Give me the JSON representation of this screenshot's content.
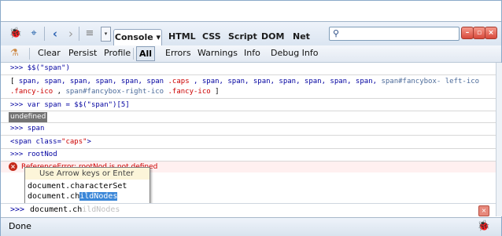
{
  "toolbar": {
    "tabs": [
      {
        "label": "Console",
        "arrow": "▾"
      },
      {
        "label": "HTML"
      },
      {
        "label": "CSS"
      },
      {
        "label": "Script"
      },
      {
        "label": "DOM"
      },
      {
        "label": "Net"
      }
    ],
    "search": {
      "value": ""
    }
  },
  "console_toolbar": {
    "buttons": [
      "Clear",
      "Persist",
      "Profile"
    ],
    "filters": [
      "All",
      "Errors",
      "Warnings",
      "Info",
      "Debug Info"
    ]
  },
  "console": {
    "prompt": ">>>",
    "line1_cmd": "$$(\"span\")",
    "line2": {
      "open": "[ ",
      "items_plain_1": "span, span, span, span, span, ",
      "caps_item_a": "span",
      "caps_item_b": ".caps",
      "items_plain_2": ", span, span, span, span, span, span, span, ",
      "fancy1_a": "span#fancybox-",
      "fancy1_b": "left-ico",
      "fancy1_c": ".fancy-ico",
      "comma": ", ",
      "fancy2_a": "span#fancybox-right-ico",
      "fancy2_b": ".fancy-ico",
      "close": " ]"
    },
    "line3_cmd": "var span = $$(\"span\")[5]",
    "line4_value": "undefined",
    "line5_cmd": "span",
    "line6": {
      "tag_open": "<span class=",
      "attr_value": "\"caps\"",
      "tag_close": ">"
    },
    "line7_cmd": "rootNod",
    "line8_error": "ReferenceError: rootNod is not defined"
  },
  "autocomplete": {
    "hint": "Use Arrow keys or Enter",
    "items": [
      {
        "typed": "document.ch",
        "rest": "aracterSet"
      },
      {
        "typed": "document.ch",
        "rest": "ildNodes"
      }
    ]
  },
  "command_line": {
    "prompt": ">>>",
    "typed": "document.ch",
    "suggestion": "ildNodes"
  },
  "status": {
    "text": "Done"
  }
}
